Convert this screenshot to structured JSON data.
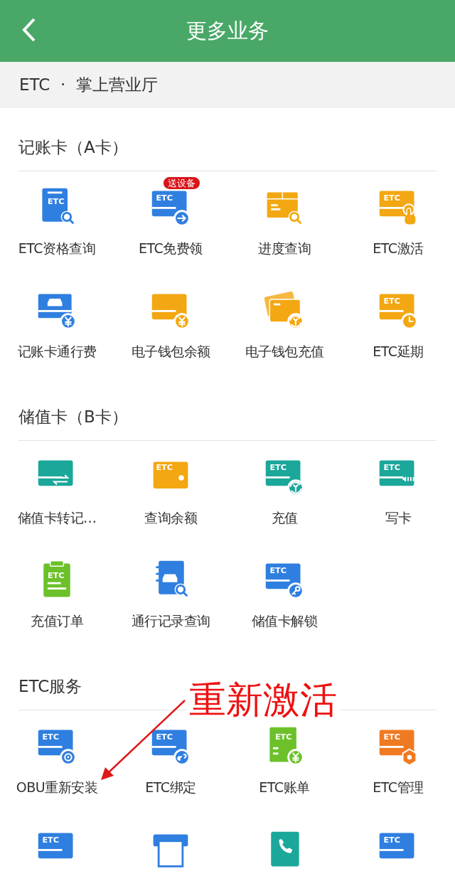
{
  "header": {
    "title": "更多业务"
  },
  "breadcrumb": "ETC  ·  掌上营业厅",
  "sections": [
    {
      "title": "记账卡（A卡）",
      "items": [
        {
          "label": "ETC资格查询",
          "kind": "doc_search",
          "color": "#2f7fe0",
          "icon_text": "ETC"
        },
        {
          "label": "ETC免费领",
          "kind": "card_arrow",
          "color": "#2f7fe0",
          "icon_text": "ETC",
          "tag": "送设备"
        },
        {
          "label": "进度查询",
          "kind": "box_search",
          "color": "#f3a712"
        },
        {
          "label": "ETC激活",
          "kind": "card_tap",
          "color": "#f3a712",
          "icon_text": "ETC"
        },
        {
          "label": "记账卡通行费",
          "kind": "carcard_yen",
          "color": "#2f7fe0"
        },
        {
          "label": "电子钱包余额",
          "kind": "card_yen",
          "color": "#f3a712"
        },
        {
          "label": "电子钱包充值",
          "kind": "cards_recharge",
          "color": "#f3a712"
        },
        {
          "label": "ETC延期",
          "kind": "card_clock",
          "color": "#f3a712",
          "icon_text": "ETC"
        }
      ]
    },
    {
      "title": "储值卡（B卡）",
      "items": [
        {
          "label": "储值卡转记…",
          "kind": "card_swap",
          "color": "#1ba79a"
        },
        {
          "label": "查询余额",
          "kind": "wallet",
          "color": "#f3a712",
          "icon_text": "ETC"
        },
        {
          "label": "充值",
          "kind": "card_recharge",
          "color": "#1ba79a",
          "icon_text": "ETC"
        },
        {
          "label": "写卡",
          "kind": "card_write",
          "color": "#1ba79a",
          "icon_text": "ETC"
        },
        {
          "label": "充值订单",
          "kind": "clipboard",
          "color": "#6cc12a",
          "icon_text": "ETC"
        },
        {
          "label": "通行记录查询",
          "kind": "book_search",
          "color": "#2f7fe0"
        },
        {
          "label": "储值卡解锁",
          "kind": "card_key",
          "color": "#2f7fe0",
          "icon_text": "ETC"
        }
      ]
    },
    {
      "title": "ETC服务",
      "items": [
        {
          "label": "OBU重新安装",
          "kind": "card_reset",
          "color": "#2f7fe0",
          "icon_text": "ETC"
        },
        {
          "label": "ETC绑定",
          "kind": "card_link",
          "color": "#2f7fe0",
          "icon_text": "ETC"
        },
        {
          "label": "ETC账单",
          "kind": "bill_yen",
          "color": "#6cc12a",
          "icon_text": "ETC"
        },
        {
          "label": "ETC管理",
          "kind": "card_nut",
          "color": "#f07a22",
          "icon_text": "ETC"
        },
        {
          "kind": "card",
          "color": "#2f7fe0",
          "icon_text": "ETC"
        },
        {
          "kind": "printer",
          "color": "#2f7fe0"
        },
        {
          "kind": "phonebook",
          "color": "#1ba79a"
        },
        {
          "kind": "card",
          "color": "#2f7fe0",
          "icon_text": "ETC"
        }
      ]
    }
  ],
  "annotation": {
    "text": "重新激活"
  }
}
